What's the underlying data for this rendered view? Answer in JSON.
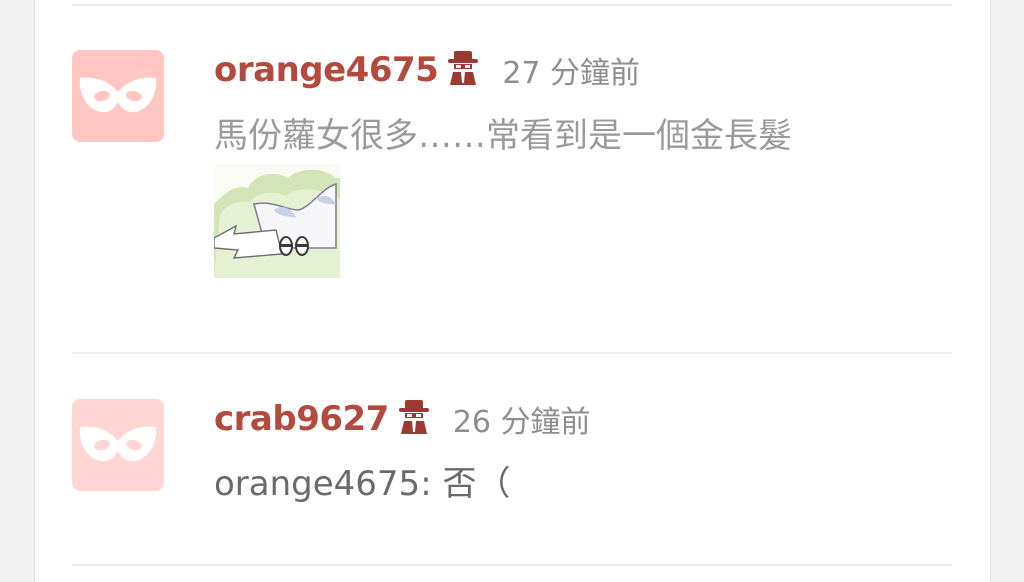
{
  "colors": {
    "author": "#b24a3e",
    "timestamp": "#8e8e8e",
    "content_faded": "#9a9a9a",
    "content": "#6a6a6a",
    "avatar_bg_1": "#ffc6c2",
    "avatar_bg_2": "#ffd6d3",
    "divider": "#ececec"
  },
  "comments": [
    {
      "author": "orange4675",
      "badge_icon": "spy-hat-icon",
      "time": "27 分鐘前",
      "text": "馬份蘿女很多……常看到是一個金長髮",
      "avatar_icon": "mask-icon",
      "sticker_icon": "cat-sticker"
    },
    {
      "author": "crab9627",
      "badge_icon": "spy-hat-icon",
      "time": "26 分鐘前",
      "text": "orange4675: 否（",
      "avatar_icon": "mask-icon"
    }
  ]
}
